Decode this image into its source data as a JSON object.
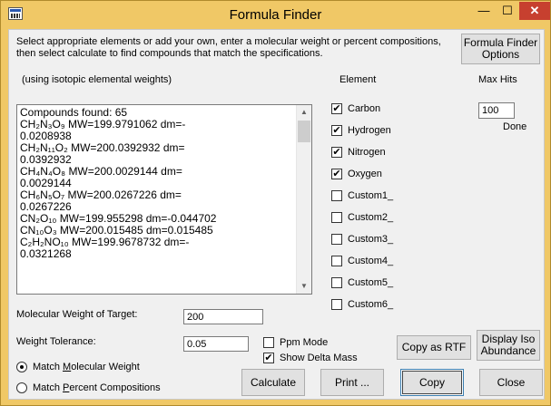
{
  "window": {
    "title": "Formula Finder",
    "minimize": "—",
    "maximize": "☐",
    "close": "✕"
  },
  "instructions": {
    "text": "Select appropriate elements or add your own, enter a molecular weight or percent compositions, then select calculate to find compounds that match the specifications."
  },
  "options_button": {
    "line1": "Formula Finder",
    "line2": "Options"
  },
  "isotopic_note": "(using isotopic elemental weights)",
  "element_header": "Element",
  "max_hits_header": "Max Hits",
  "max_hits_value": "100",
  "done_label": "Done",
  "results": {
    "lines": [
      "Compounds found:  65",
      "CH₂N₃O₉            MW=199.9791062       dm=-",
      "0.0208938",
      "CH₂N₁₁O₂           MW=200.0392932       dm=",
      "0.0392932",
      "CH₄N₄O₈            MW=200.0029144       dm=",
      "0.0029144",
      "CH₆N₅O₇            MW=200.0267226       dm=",
      "0.0267226",
      "CN₂O₁₀ MW=199.955298           dm=-0.044702",
      "CN₁₀O₃ MW=200.015485           dm=0.015485",
      "C₂H₂NO₁₀         MW=199.9678732       dm=-",
      "0.0321268"
    ]
  },
  "elements": [
    {
      "label": "Carbon",
      "checked": true
    },
    {
      "label": "Hydrogen",
      "checked": true
    },
    {
      "label": "Nitrogen",
      "checked": true
    },
    {
      "label": "Oxygen",
      "checked": true
    },
    {
      "label": "Custom1_",
      "checked": false
    },
    {
      "label": "Custom2_",
      "checked": false
    },
    {
      "label": "Custom3_",
      "checked": false
    },
    {
      "label": "Custom4_",
      "checked": false
    },
    {
      "label": "Custom5_",
      "checked": false
    },
    {
      "label": "Custom6_",
      "checked": false
    }
  ],
  "target": {
    "label": "Molecular Weight of Target:",
    "value": "200"
  },
  "tolerance": {
    "label": "Weight Tolerance:",
    "value": "0.05"
  },
  "ppm_mode": {
    "label": "Ppm Mode",
    "checked": false
  },
  "show_delta": {
    "label": "Show Delta Mass",
    "checked": true
  },
  "radio_mw": {
    "pre": "Match ",
    "u": "M",
    "post": "olecular Weight",
    "selected": true
  },
  "radio_pc": {
    "pre": "Match ",
    "u": "P",
    "post": "ercent Compositions",
    "selected": false
  },
  "buttons": {
    "copy_rtf": "Copy as RTF",
    "display_iso_1": "Display Iso",
    "display_iso_2": "Abundance",
    "calculate": "Calculate",
    "print": "Print ...",
    "copy": "Copy",
    "close": "Close"
  }
}
